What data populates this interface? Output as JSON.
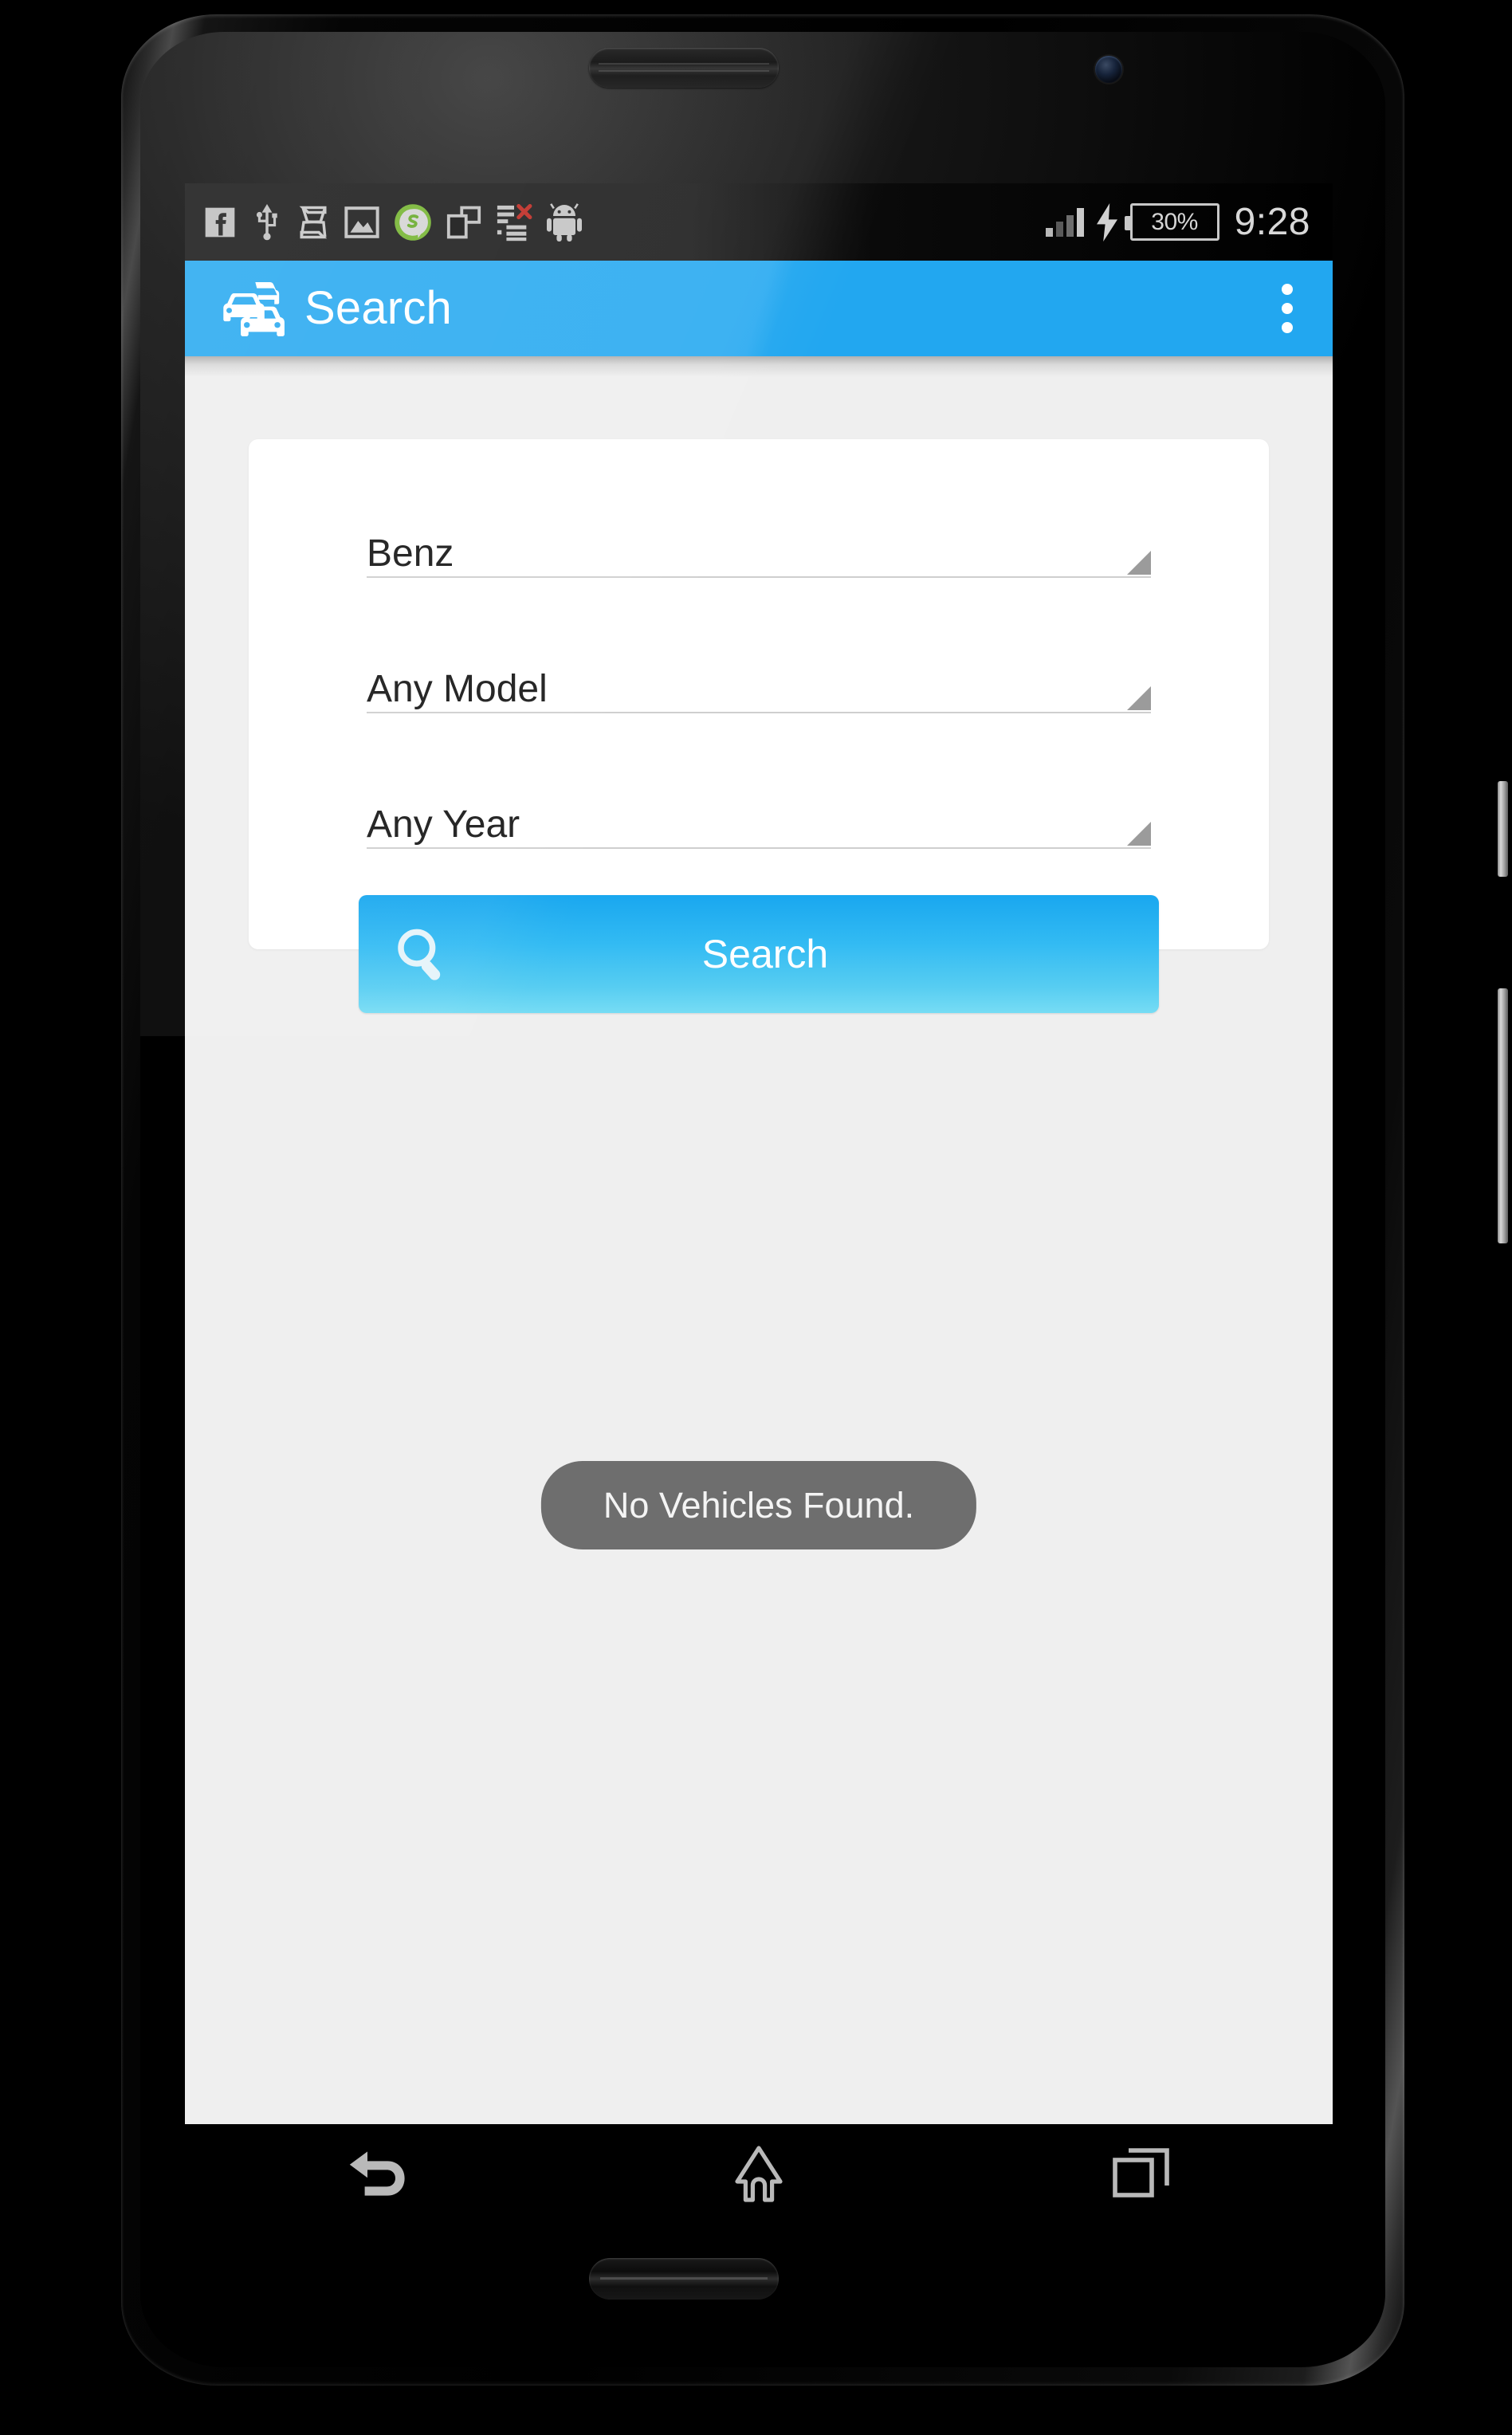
{
  "device": {
    "type": "android-smartphone",
    "earpiece": "earpiece-speaker",
    "front_camera": "front-camera-lens",
    "bottom_speaker": "bottom-speaker-grille",
    "power_key": "power-button",
    "volume_key": "volume-rocker"
  },
  "status_bar": {
    "background": "#262626",
    "left_icons": [
      {
        "name": "facebook-icon",
        "label": "Facebook"
      },
      {
        "name": "usb-icon",
        "label": "USB connected"
      },
      {
        "name": "s-logo-icon",
        "label": "S App"
      },
      {
        "name": "gallery-image-icon",
        "label": "Screenshot captured"
      },
      {
        "name": "green-s-chat-icon",
        "label": "Messaging"
      },
      {
        "name": "screen-mirror-icon",
        "label": "Screen mirroring"
      },
      {
        "name": "list-error-icon",
        "label": "Sync error"
      },
      {
        "name": "android-robot-icon",
        "label": "Android system"
      }
    ],
    "signal": {
      "name": "signal-bars-icon",
      "bars_total": 4,
      "bars_active": 4,
      "label": "Signal strength"
    },
    "charging": {
      "name": "charging-bolt-icon",
      "label": "Charging"
    },
    "battery": {
      "name": "battery-icon",
      "percent_label": "30%",
      "percent_value": 30
    },
    "clock": "9:28"
  },
  "app_bar": {
    "background": "#22a7f0",
    "logo": {
      "name": "traffic-cars-icon",
      "label": "Vehicle app logo"
    },
    "title": "Search",
    "overflow": {
      "name": "overflow-menu-icon",
      "label": "More options"
    }
  },
  "search_form": {
    "card_background": "#ffffff",
    "page_background": "#efefef",
    "spinners": [
      {
        "name": "make-spinner",
        "value": "Benz",
        "caret": "dropdown-caret-icon"
      },
      {
        "name": "model-spinner",
        "value": "Any Model",
        "caret": "dropdown-caret-icon"
      },
      {
        "name": "year-spinner",
        "value": "Any Year",
        "caret": "dropdown-caret-icon"
      }
    ],
    "submit": {
      "name": "search-button",
      "label": "Search",
      "icon": "magnifier-icon",
      "gradient_top": "#19a7ef",
      "gradient_bottom": "#76dcf4"
    }
  },
  "toast": {
    "message": "No Vehicles Found.",
    "background": "rgba(104,104,104,0.96)",
    "text_color": "#f4f4f4"
  },
  "nav_bar": {
    "background": "#000000",
    "buttons": [
      {
        "name": "nav-back-button",
        "icon": "back-arrow-icon",
        "label": "Back"
      },
      {
        "name": "nav-home-button",
        "icon": "home-icon",
        "label": "Home"
      },
      {
        "name": "nav-recents-button",
        "icon": "recent-apps-icon",
        "label": "Recent apps"
      }
    ]
  }
}
